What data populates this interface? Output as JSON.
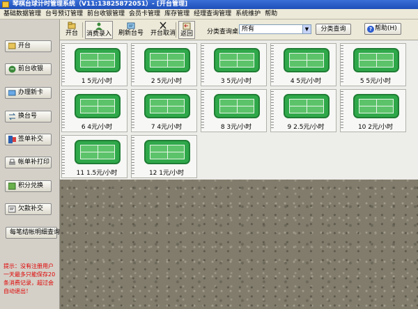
{
  "window": {
    "title": "琴棋台球计时管理系统（V11:13825872051）- [开台管理]"
  },
  "menu": [
    "基础数据管理",
    "台号预订管理",
    "前台收银管理",
    "会员卡管理",
    "库存管理",
    "经理查询管理",
    "系统维护",
    "帮助"
  ],
  "toolbar": {
    "open_table": "开台",
    "consume_entry": "消费录入",
    "refresh_tables": "刷新台号",
    "cancel_open": "开台取消",
    "back": "返回",
    "filter_label": "分类查询桌台",
    "filter_value": "所有",
    "query_button": "分类查询",
    "help_button": "帮助(H)"
  },
  "sidebar": {
    "buttons": [
      "开台",
      "前台收银",
      "办理新卡",
      "换台号",
      "签单补交",
      "帐单补打印",
      "积分兑换",
      "欠款补交"
    ],
    "records_button": "每笔结帐明细查询",
    "notice": "提示：没有注册用户一天最多只能保存20条消费记录，超过会自动退出！"
  },
  "tables": [
    {
      "label": "1 5元/小时"
    },
    {
      "label": "2 5元/小时"
    },
    {
      "label": "3 5元/小时"
    },
    {
      "label": "4 5元/小时"
    },
    {
      "label": "5 5元/小时"
    },
    {
      "label": "6 4元/小时"
    },
    {
      "label": "7 4元/小时"
    },
    {
      "label": "8 3元/小时"
    },
    {
      "label": "9 2.5元/小时"
    },
    {
      "label": "10 2元/小时"
    },
    {
      "label": "11 1.5元/小时"
    },
    {
      "label": "12 1元/小时"
    }
  ],
  "colors": {
    "court_green": "#2fa84a",
    "notice_red": "#e00000",
    "titlebar_blue": "#1f4fb8"
  }
}
